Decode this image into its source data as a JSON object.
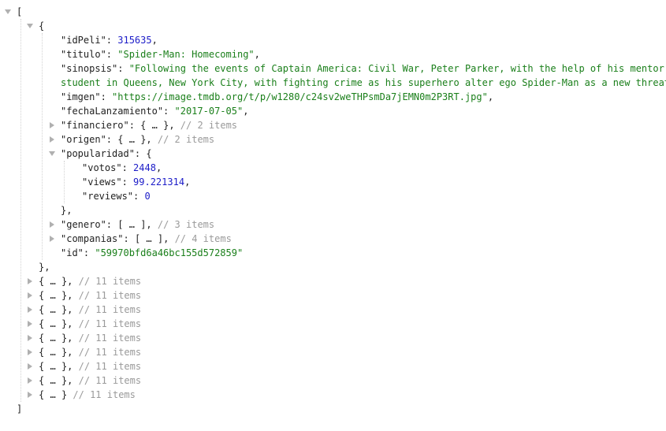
{
  "colors": {
    "key": "#222222",
    "string": "#1a7f1a",
    "number": "#1c1cc8",
    "comment": "#9a9a9a",
    "toggle": "#b0b0b0"
  },
  "root": {
    "open": "[",
    "close": "]"
  },
  "first": {
    "open": "{",
    "close": "},",
    "fields": [
      {
        "key": "\"idPeli\"",
        "value": "315635",
        "type": "num",
        "trail": ","
      },
      {
        "key": "\"titulo\"",
        "value": "\"Spider-Man: Homecoming\"",
        "type": "str",
        "trail": ","
      },
      {
        "key": "\"sinopsis\"",
        "value": "\"Following the events of Captain America: Civil War, Peter Parker, with the help of his mentor T",
        "type": "str",
        "trail": ""
      },
      {
        "key": "",
        "value": "student in Queens, New York City, with fighting crime as his superhero alter ego Spider-Man as a new threat,",
        "type": "str",
        "trail": ""
      },
      {
        "key": "\"imgen\"",
        "value": "\"https://image.tmdb.org/t/p/w1280/c24sv2weTHPsmDa7jEMN0m2P3RT.jpg\"",
        "type": "str",
        "trail": ","
      },
      {
        "key": "\"fechaLanzamiento\"",
        "value": "\"2017-07-05\"",
        "type": "str",
        "trail": ","
      }
    ],
    "financiero": {
      "key": "\"financiero\"",
      "open": "{",
      "ellipsis": "…",
      "close": "},",
      "comment": "// 2 items"
    },
    "origen": {
      "key": "\"origen\"",
      "open": "{",
      "ellipsis": "…",
      "close": "},",
      "comment": "// 2 items"
    },
    "popularidad": {
      "key": "\"popularidad\"",
      "open": "{",
      "close": "},",
      "fields": [
        {
          "key": "\"votos\"",
          "value": "2448",
          "type": "num",
          "trail": ","
        },
        {
          "key": "\"views\"",
          "value": "99.221314",
          "type": "num",
          "trail": ","
        },
        {
          "key": "\"reviews\"",
          "value": "0",
          "type": "num",
          "trail": ""
        }
      ]
    },
    "genero": {
      "key": "\"genero\"",
      "open": "[",
      "ellipsis": "…",
      "close": "],",
      "comment": "// 3 items"
    },
    "companias": {
      "key": "\"companias\"",
      "open": "[",
      "ellipsis": "…",
      "close": "],",
      "comment": "// 4 items"
    },
    "id": {
      "key": "\"id\"",
      "value": "\"59970bfd6a46bc155d572859\""
    }
  },
  "collapsed_items": [
    {
      "open": "{",
      "ellipsis": "…",
      "close": "},",
      "comment": "// 11 items"
    },
    {
      "open": "{",
      "ellipsis": "…",
      "close": "},",
      "comment": "// 11 items"
    },
    {
      "open": "{",
      "ellipsis": "…",
      "close": "},",
      "comment": "// 11 items"
    },
    {
      "open": "{",
      "ellipsis": "…",
      "close": "},",
      "comment": "// 11 items"
    },
    {
      "open": "{",
      "ellipsis": "…",
      "close": "},",
      "comment": "// 11 items"
    },
    {
      "open": "{",
      "ellipsis": "…",
      "close": "},",
      "comment": "// 11 items"
    },
    {
      "open": "{",
      "ellipsis": "…",
      "close": "},",
      "comment": "// 11 items"
    },
    {
      "open": "{",
      "ellipsis": "…",
      "close": "},",
      "comment": "// 11 items"
    },
    {
      "open": "{",
      "ellipsis": "…",
      "close": "}",
      "comment": "// 11 items"
    }
  ]
}
